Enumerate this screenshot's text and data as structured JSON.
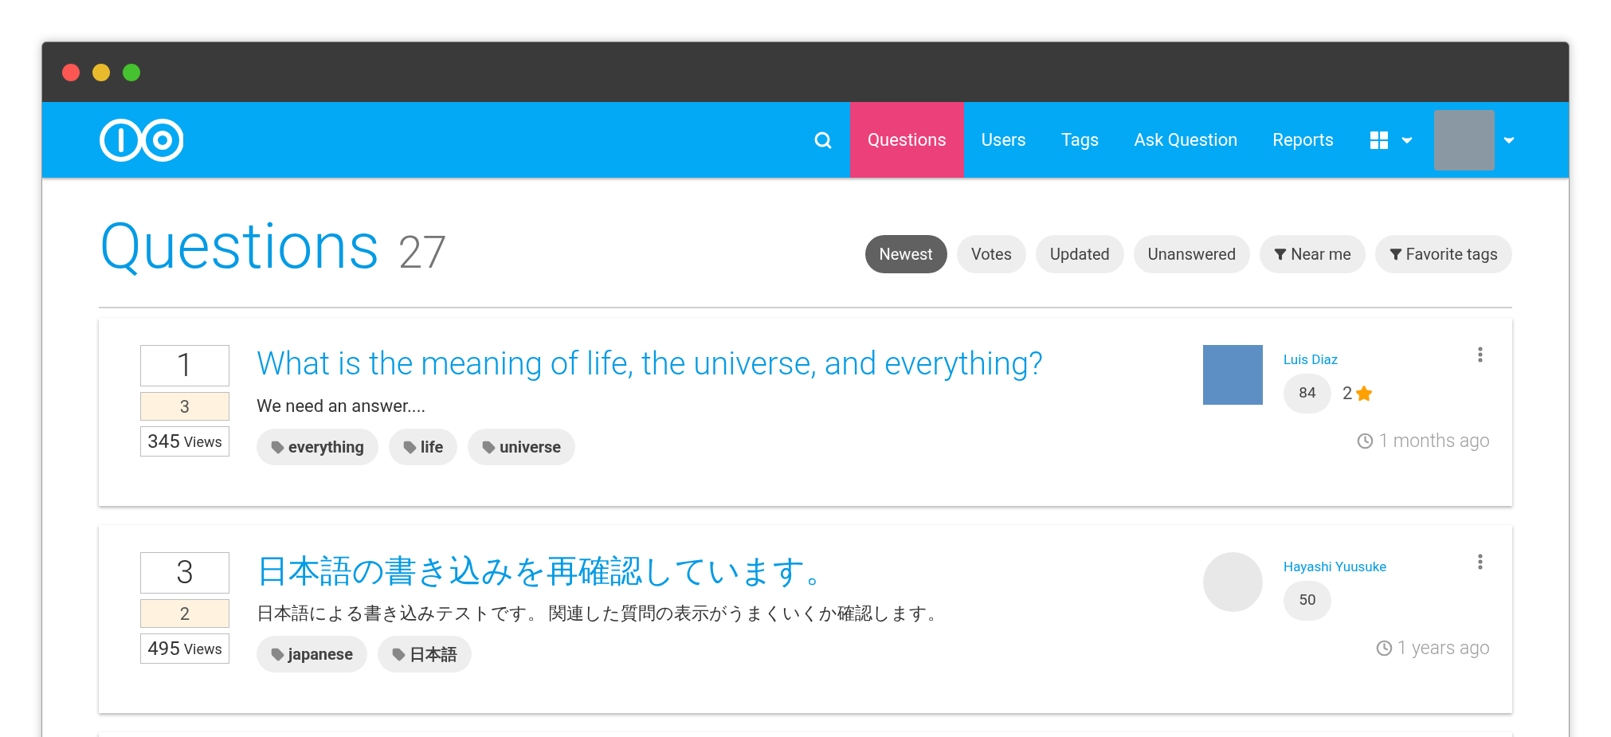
{
  "nav": {
    "items": [
      {
        "label": "Questions",
        "selected": true
      },
      {
        "label": "Users",
        "selected": false
      },
      {
        "label": "Tags",
        "selected": false
      },
      {
        "label": "Ask Question",
        "selected": false
      },
      {
        "label": "Reports",
        "selected": false
      }
    ]
  },
  "heading": {
    "title": "Questions",
    "count": "27"
  },
  "filters": [
    {
      "label": "Newest",
      "selected": true,
      "kind": "sort"
    },
    {
      "label": "Votes",
      "selected": false,
      "kind": "sort"
    },
    {
      "label": "Updated",
      "selected": false,
      "kind": "sort"
    },
    {
      "label": "Unanswered",
      "selected": false,
      "kind": "sort"
    },
    {
      "label": "Near me",
      "selected": false,
      "kind": "filter"
    },
    {
      "label": "Favorite tags",
      "selected": false,
      "kind": "filter"
    }
  ],
  "questions": [
    {
      "votes": "1",
      "answers": "3",
      "views": "345",
      "views_label": "Views",
      "title": "What is the meaning of life, the universe, and everything?",
      "excerpt": "We need an answer....",
      "tags": [
        "everything",
        "life",
        "universe"
      ],
      "author": "Luis Diaz",
      "reputation": "84",
      "badge_count": "2",
      "time": "1 months ago"
    },
    {
      "votes": "3",
      "answers": "2",
      "views": "495",
      "views_label": "Views",
      "title": "日本語の書き込みを再確認しています。",
      "excerpt": "日本語による書き込みテストです。 関連した質問の表示がうまくいくか確認します。",
      "tags": [
        "japanese",
        "日本語"
      ],
      "author": "Hayashi Yuusuke",
      "reputation": "50",
      "time": "1 years ago"
    }
  ]
}
